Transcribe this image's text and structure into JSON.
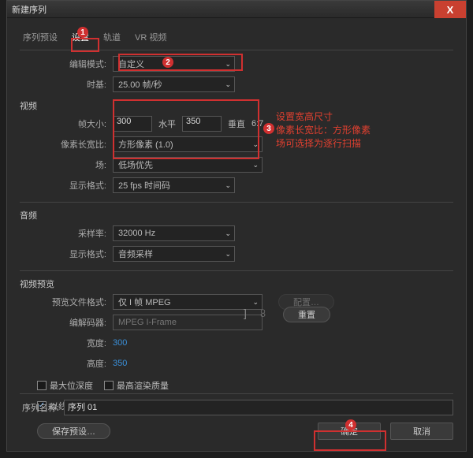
{
  "window": {
    "title": "新建序列"
  },
  "tabs": {
    "preset": "序列预设",
    "settings": "设置",
    "tracks": "轨道",
    "vr": "VR 视频"
  },
  "edit": {
    "mode_label": "编辑模式:",
    "mode_value": "自定义",
    "timebase_label": "时基:",
    "timebase_value": "25.00 帧/秒"
  },
  "video": {
    "section": "视频",
    "framesize_label": "帧大小:",
    "width": "300",
    "h_label": "水平",
    "height": "350",
    "v_label": "垂直",
    "ratio": "6:7",
    "par_label": "像素长宽比:",
    "par_value": "方形像素 (1.0)",
    "fields_label": "场:",
    "fields_value": "低场优先",
    "fmt_label": "显示格式:",
    "fmt_value": "25 fps 时间码"
  },
  "audio": {
    "section": "音频",
    "rate_label": "采样率:",
    "rate_value": "32000 Hz",
    "fmt_label": "显示格式:",
    "fmt_value": "音频采样"
  },
  "preview": {
    "section": "视频预览",
    "file_label": "预览文件格式:",
    "file_value": "仅 I 帧 MPEG",
    "codec_label": "编解码器:",
    "codec_value": "MPEG I-Frame",
    "w_label": "宽度:",
    "w_value": "300",
    "h_label": "高度:",
    "h_value": "350",
    "config": "配置…",
    "reset": "重置"
  },
  "checks": {
    "maxdepth": "最大位深度",
    "maxrender": "最高渲染质量",
    "linear": "以线性颜色合成（要求 GPU 加速或最高渲染品质）"
  },
  "buttons": {
    "save": "保存预设…",
    "ok": "确定",
    "cancel": "取消"
  },
  "seq": {
    "label": "序列名称:",
    "value": "序列 01"
  },
  "anno": {
    "line1": "设置宽高尺寸",
    "line2": "像素长宽比：方形像素",
    "line3": "场可选择为逐行扫描"
  }
}
